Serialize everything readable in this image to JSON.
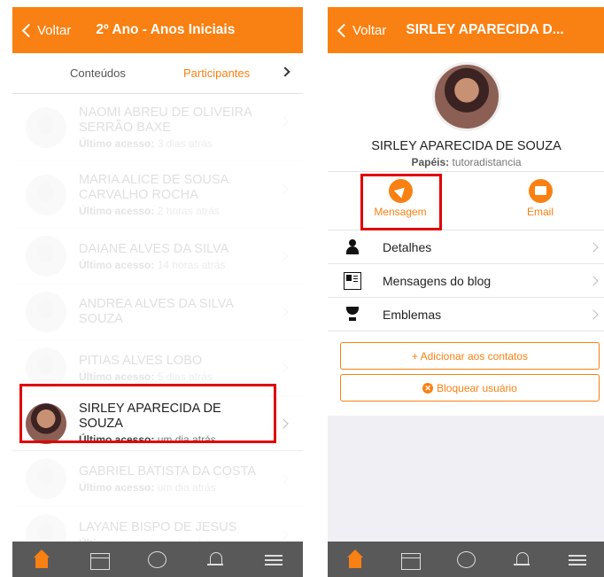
{
  "left": {
    "header": {
      "back_label": "Voltar",
      "title": "2º Ano - Anos Iniciais"
    },
    "tabs": {
      "conteudos": "Conteúdos",
      "participantes": "Participantes"
    },
    "participants": [
      {
        "name": "NAOMI ABREU DE OLIVEIRA SERRÃO BAXE",
        "access_label": "Último acesso:",
        "access": "3 dias atrás"
      },
      {
        "name": "MARIA ALICE DE SOUSA CARVALHO ROCHA",
        "access_label": "Último acesso:",
        "access": "2 horas atrás"
      },
      {
        "name": "DAIANE ALVES DA SILVA",
        "access_label": "Último acesso:",
        "access": "14 horas atrás"
      },
      {
        "name": "ANDREA ALVES DA SILVA SOUZA",
        "access_label": "",
        "access": ""
      },
      {
        "name": "PITIAS ALVES LOBO",
        "access_label": "Último acesso:",
        "access": "5 dias atrás"
      },
      {
        "name": "SIRLEY APARECIDA DE SOUZA",
        "access_label": "Último acesso:",
        "access": "um dia atrás"
      },
      {
        "name": "GABRIEL BATISTA DA COSTA",
        "access_label": "Último acesso:",
        "access": "um dia atrás"
      },
      {
        "name": "LAYANE BISPO DE JESUS",
        "access_label": "Último acesso:",
        "access": "um dia atrás"
      }
    ]
  },
  "right": {
    "header": {
      "back_label": "Voltar",
      "title": "SIRLEY APARECIDA D..."
    },
    "profile": {
      "name": "SIRLEY APARECIDA DE SOUZA",
      "roles_label": "Papéis:",
      "roles": "tutoradistancia"
    },
    "actions": {
      "message": "Mensagem",
      "email": "Email"
    },
    "menu": [
      {
        "label": "Detalhes",
        "icon": "person-icon"
      },
      {
        "label": "Mensagens do blog",
        "icon": "blog-icon"
      },
      {
        "label": "Emblemas",
        "icon": "trophy-icon"
      }
    ],
    "buttons": {
      "add_contact": "+ Adicionar aos contatos",
      "block_user": "Bloquear usuário"
    }
  },
  "colors": {
    "brand": "#f98012",
    "tabbar": "#595959",
    "highlight": "#e00000"
  },
  "tabbar_icons": [
    "home-icon",
    "calendar-icon",
    "chat-icon",
    "bell-icon",
    "menu-icon"
  ]
}
